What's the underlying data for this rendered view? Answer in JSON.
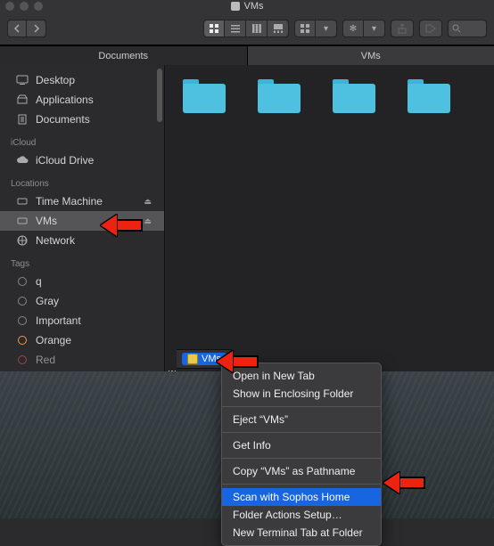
{
  "window": {
    "title": "VMs"
  },
  "tabs": [
    "Documents",
    "VMs"
  ],
  "sidebar": {
    "favorites": [
      {
        "label": "Desktop",
        "icon": "desktop"
      },
      {
        "label": "Applications",
        "icon": "apps"
      },
      {
        "label": "Documents",
        "icon": "docs"
      }
    ],
    "icloud_header": "iCloud",
    "icloud": [
      {
        "label": "iCloud Drive",
        "icon": "cloud"
      }
    ],
    "locations_header": "Locations",
    "locations": [
      {
        "label": "Time Machine",
        "icon": "disk",
        "eject": true
      },
      {
        "label": "VMs",
        "icon": "disk",
        "eject": true,
        "selected": true
      },
      {
        "label": "Network",
        "icon": "globe"
      }
    ],
    "tags_header": "Tags",
    "tags": [
      {
        "label": "q",
        "color": "gray"
      },
      {
        "label": "Gray",
        "color": "gray"
      },
      {
        "label": "Important",
        "color": "gray"
      },
      {
        "label": "Orange",
        "color": "orange"
      },
      {
        "label": "Red",
        "color": "red"
      }
    ]
  },
  "content": {
    "truncated_item_label": "w"
  },
  "pathbar": {
    "item": "VMs"
  },
  "context_menu": {
    "items": [
      "Open in New Tab",
      "Show in Enclosing Folder",
      "Eject “VMs”",
      "Get Info",
      "Copy “VMs” as Pathname",
      "Scan with Sophos Home",
      "Folder Actions Setup…",
      "New Terminal Tab at Folder"
    ],
    "highlighted_index": 5
  }
}
